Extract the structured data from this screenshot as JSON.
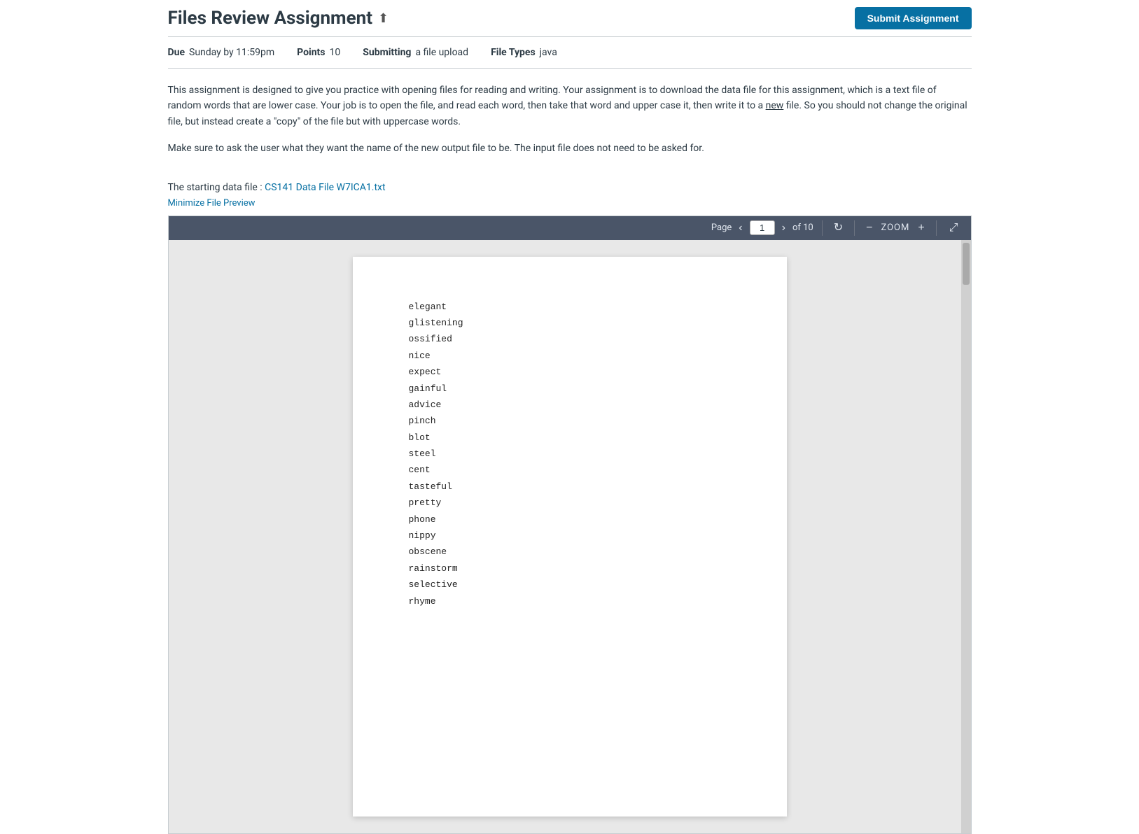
{
  "header": {
    "title": "Files Review Assignment",
    "title_icon": "✦",
    "submit_button_label": "Submit Assignment"
  },
  "meta": {
    "due_label": "Due",
    "due_value": "Sunday by 11:59pm",
    "points_label": "Points",
    "points_value": "10",
    "submitting_label": "Submitting",
    "submitting_value": "a file upload",
    "file_types_label": "File Types",
    "file_types_value": "java"
  },
  "description": {
    "paragraph1": "This assignment is designed to give you practice with opening files for reading and writing.  Your assignment is to download the data file for this assignment, which is a text file of random words that are lower case.   Your job is to open the file, and read each word, then take that word and upper case it, then write it to a new file.  So you should not change the original file, but instead create a \"copy\" of the file but with uppercase words.",
    "paragraph2": "Make sure to ask the user what they want the name of the new output file to be.  The input file does not need to be asked for.",
    "data_file_prefix": "The starting data file : ",
    "data_file_link_text": "CS141 Data File W7ICA1.txt",
    "minimize_link_text": "Minimize File Preview"
  },
  "pdf_viewer": {
    "page_label": "Page",
    "page_current": "1",
    "page_total_label": "of 10",
    "prev_icon": "‹",
    "next_icon": "›",
    "refresh_icon": "↻",
    "zoom_minus_icon": "−",
    "zoom_label": "ZOOM",
    "zoom_plus_icon": "+",
    "expand_icon": "⤢"
  },
  "pdf_content": {
    "words": [
      "elegant",
      "glistening",
      "ossified",
      "nice",
      "expect",
      "gainful",
      "advice",
      "pinch",
      "blot",
      "steel",
      "cent",
      "tasteful",
      "pretty",
      "phone",
      "nippy",
      "obscene",
      "rainstorm",
      "selective",
      "rhyme"
    ]
  }
}
